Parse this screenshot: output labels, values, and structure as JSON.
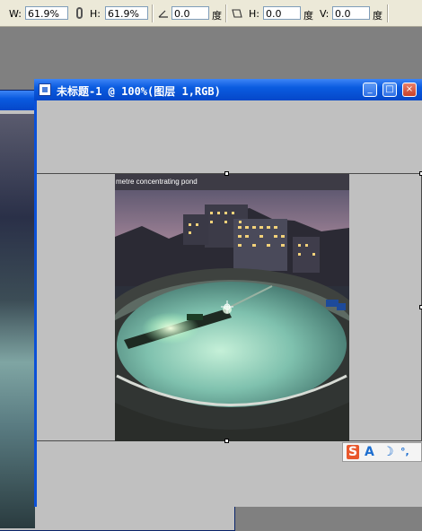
{
  "options_bar": {
    "w_label": "W:",
    "w_value": "61.9%",
    "h_label": "H:",
    "h_value": "61.9%",
    "angle_value": "0.0",
    "angle_unit": "度",
    "skew_h_label": "H:",
    "skew_h_value": "0.0",
    "skew_h_unit": "度",
    "skew_v_label": "V:",
    "skew_v_value": "0.0",
    "skew_v_unit": "度"
  },
  "main_window": {
    "title": "未标题-1 @ 100%(图层 1,RGB)"
  },
  "photo": {
    "caption": "metre concentrating pond"
  },
  "ime_bar": {
    "logo": "S",
    "mode": "A",
    "moon": "☽",
    "punct": "°,"
  },
  "colors": {
    "titlebar": "#0a5be0",
    "workspace": "#808080",
    "canvas_bg": "#c0c0c0",
    "ime_logo": "#e9572c"
  }
}
